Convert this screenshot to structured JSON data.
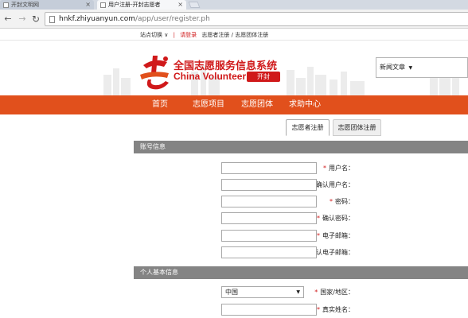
{
  "browser": {
    "tabs": [
      {
        "title": "开封文明网",
        "active": false
      },
      {
        "title": "用户注册-开封志愿者",
        "active": true
      }
    ],
    "url_host": "hnkf.zhiyuanyun.com",
    "url_path": "/app/user/register.ph"
  },
  "util_bar": {
    "site_switch": "站点切换 ∨",
    "separator": "|",
    "login": "请登录",
    "register": "志愿者注册 / 志愿团体注册"
  },
  "header": {
    "title": "全国志愿服务信息系统",
    "subtitle": "China Volunteer",
    "city_badge": "开封",
    "search_type": "新闻文章"
  },
  "nav": {
    "items": [
      "首页",
      "志愿项目",
      "志愿团体",
      "求助中心"
    ]
  },
  "register_tabs": {
    "volunteer": "志愿者注册",
    "group": "志愿团体注册"
  },
  "sections": {
    "account": "账号信息",
    "personal": "个人基本信息"
  },
  "form": {
    "username_label": "用户名：",
    "confirm_username_label": "确认用户名：",
    "password_label": "密码：",
    "confirm_password_label": "确认密码：",
    "email_label": "电子邮箱：",
    "confirm_email_label": "确认电子邮箱：",
    "country_label": "国家/地区：",
    "country_value": "中国",
    "realname_label": "真实姓名："
  },
  "colors": {
    "brand_red": "#d0191a",
    "nav_orange": "#e1501c",
    "section_gray": "#848484"
  },
  "icons": [
    "back-arrow-icon",
    "forward-arrow-icon",
    "reload-icon",
    "page-icon",
    "close-icon",
    "chevron-down-icon"
  ]
}
